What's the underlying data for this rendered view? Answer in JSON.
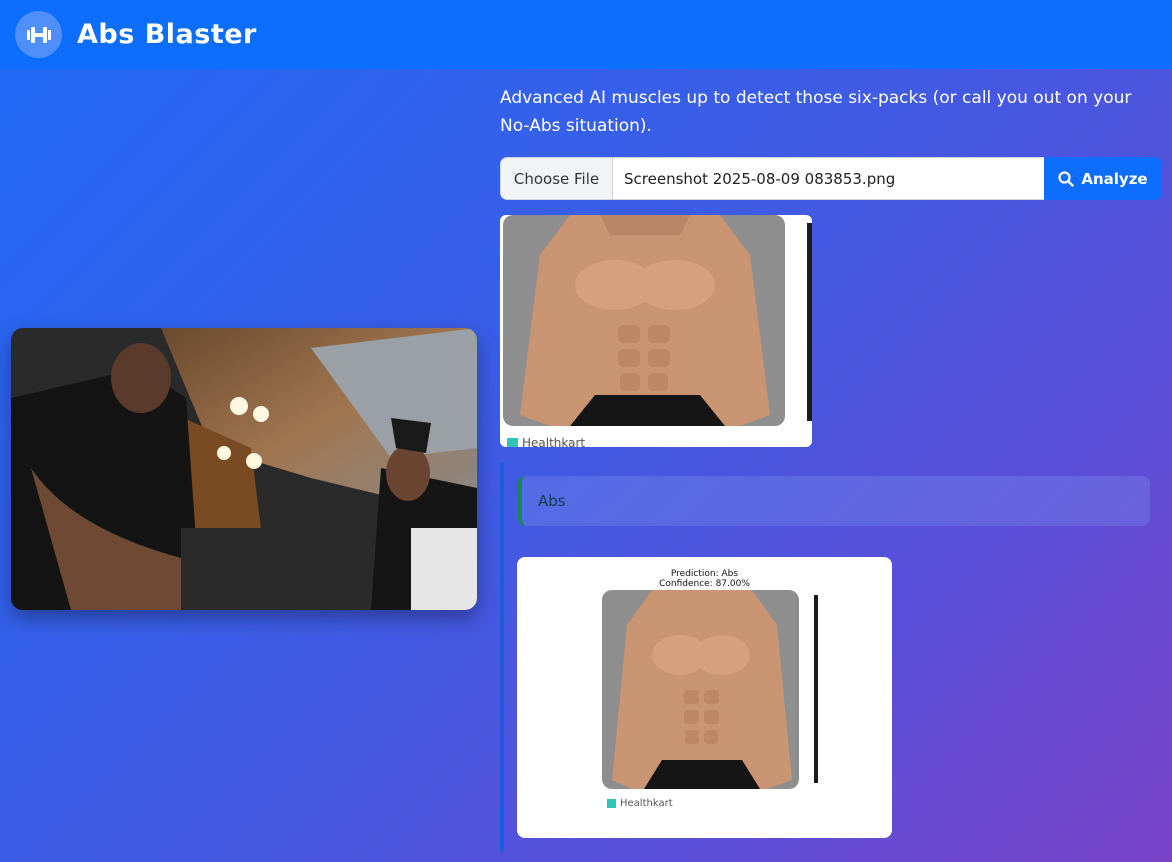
{
  "app": {
    "brand": "Abs Blaster",
    "logo_icon": "dumbbell-icon"
  },
  "hero": {
    "tagline": "Advanced AI muscles up to detect those six-packs (or call you out on your No-Abs situation)."
  },
  "upload": {
    "choose_label": "Choose File",
    "file_name": "Screenshot 2025-08-09 083853.png",
    "analyze_label": "Analyze",
    "analyze_icon": "search-icon"
  },
  "preview": {
    "watermark": "Healthkart"
  },
  "result": {
    "label": "Abs",
    "prediction": "Prediction: Abs",
    "confidence": "Confidence: 87.00%",
    "watermark": "Healthkart"
  },
  "colors": {
    "navbar": "#0d6efd",
    "accent": "#0d6efd",
    "success": "#198754"
  }
}
